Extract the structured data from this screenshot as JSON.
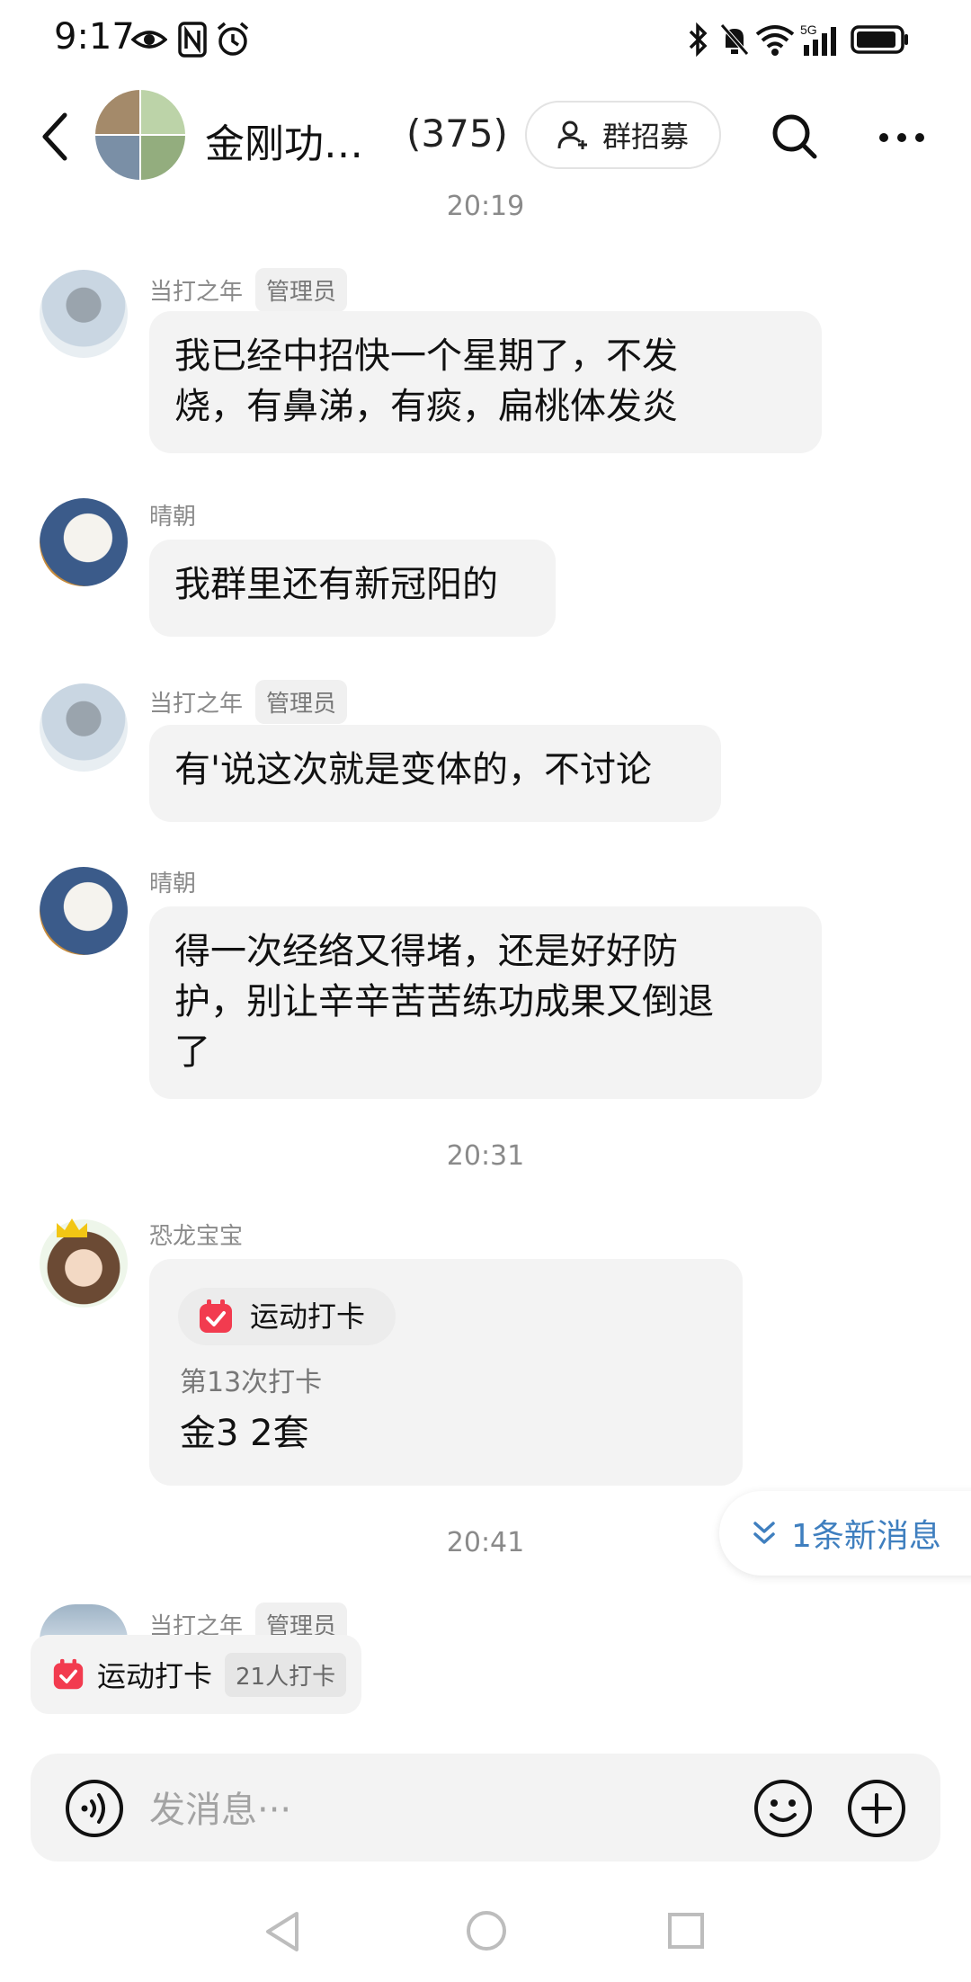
{
  "status_bar": {
    "time": "9:17",
    "left_icons": [
      "eye-icon",
      "nfc-icon",
      "alarm-icon"
    ],
    "right_icons": [
      "bluetooth-icon",
      "mute-icon",
      "wifi-icon",
      "signal-5g-icon",
      "battery-icon"
    ]
  },
  "header": {
    "title": "金刚功…",
    "member_count": "(375)",
    "recruit_label": "群招募"
  },
  "chat": {
    "time_1": "20:19",
    "time_2": "20:31",
    "time_3": "20:41",
    "messages": [
      {
        "sender": "当打之年",
        "badge": "管理员",
        "text_lines": [
          "我已经中招快一个星期了，不发",
          "烧，有鼻涕，有痰，扁桃体发炎"
        ]
      },
      {
        "sender": "晴朝",
        "text_lines": [
          "我群里还有新冠阳的"
        ]
      },
      {
        "sender": "当打之年",
        "badge": "管理员",
        "text_lines": [
          "有'说这次就是变体的，不讨论"
        ]
      },
      {
        "sender": "晴朝",
        "text_lines": [
          "得一次经络又得堵，还是好好防",
          "护，别让辛辛苦苦练功成果又倒退",
          "了"
        ]
      },
      {
        "sender": "恐龙宝宝",
        "checkin": {
          "label": "运动打卡",
          "count_text": "第13次打卡",
          "content": "金3 2套"
        }
      },
      {
        "sender": "当打之年",
        "badge": "管理员"
      }
    ]
  },
  "new_messages_label": "1条新消息",
  "floating_checkin": {
    "label": "运动打卡",
    "count": "21人打卡"
  },
  "input": {
    "placeholder": "发消息···"
  },
  "colors": {
    "accent_red": "#f23b4f",
    "link_blue": "#3f7fbf",
    "bubble_bg": "#f3f3f3"
  }
}
